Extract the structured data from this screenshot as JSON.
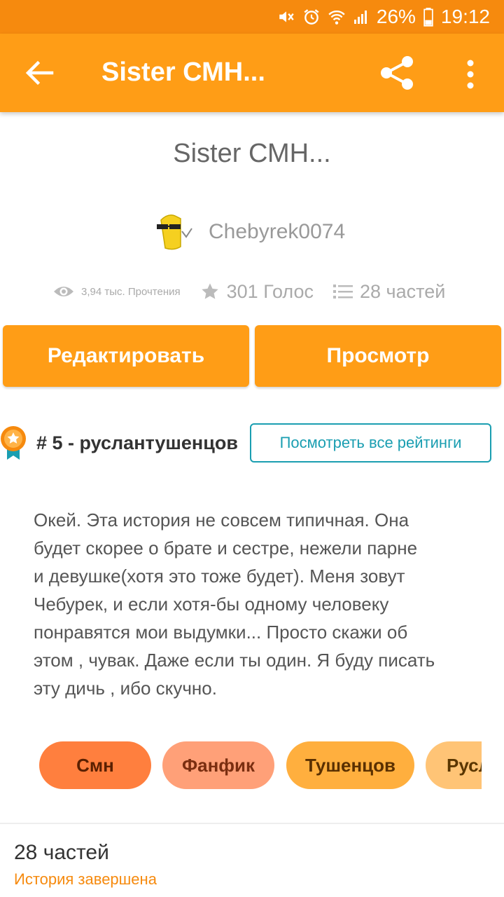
{
  "status_bar": {
    "battery": "26%",
    "time": "19:12",
    "icons": [
      "mute-icon",
      "alarm-icon",
      "wifi-icon",
      "signal-icon",
      "battery-icon"
    ]
  },
  "app_bar": {
    "title": "Sister СМН...",
    "icons": [
      "back-arrow-icon",
      "share-icon",
      "more-vert-icon"
    ]
  },
  "story": {
    "title": "Sister СМН...",
    "author": "Chebyrek0074",
    "reads": "3,94 тыс. Прочтения",
    "votes": "301 Голос",
    "parts": "28 частей",
    "description": "Окей. Эта история не совсем типичная. Она\nбудет скорее о брате и сестре, нежели парне\nи девушке(хотя это тоже будет). Меня зовут\nЧебурек, и если хотя-бы одному человеку\nпонравятся мои выдумки... Просто скажи об\nэтом , чувак. Даже если ты один. Я буду писать\nэту дичь , ибо скучно."
  },
  "buttons": {
    "edit": "Редактировать",
    "view": "Просмотр"
  },
  "ranking": {
    "label": "# 5 - руслантушенцов",
    "see_all": "Посмотреть все рейтинги"
  },
  "tags": [
    "Смн",
    "Фанфик",
    "Тушенцов",
    "Русл"
  ],
  "footer": {
    "parts": "28 частей",
    "status": "История завершена"
  },
  "colors": {
    "status_bar": "#f68a0e",
    "app_bar": "#ff9d16",
    "accent_teal": "#1a9eb1",
    "completed_text": "#f68a0e"
  }
}
